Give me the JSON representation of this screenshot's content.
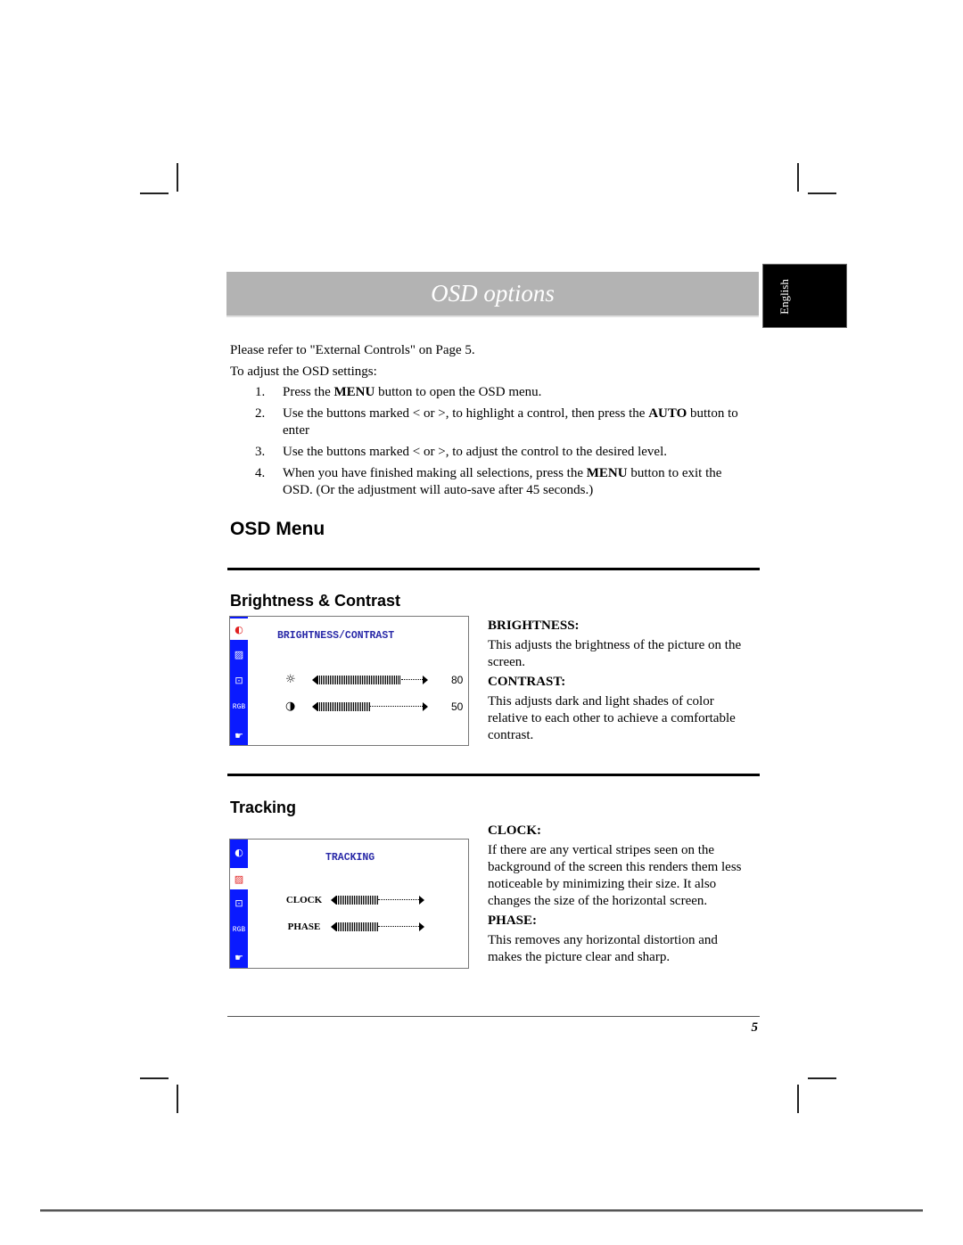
{
  "header": {
    "title": "OSD options",
    "language_tab": "English"
  },
  "intro": {
    "line1": "Please refer to \"External Controls\" on Page 5.",
    "line2": "To adjust the OSD settings:"
  },
  "steps": [
    {
      "num": "1.",
      "pre": "Press the ",
      "bold": "MENU",
      "post": " button to open the OSD menu."
    },
    {
      "num": "2.",
      "pre": "Use the buttons marked < or >, to highlight a control, then press the ",
      "bold": "AUTO",
      "post": " button to enter"
    },
    {
      "num": "3.",
      "pre": "Use the buttons marked < or >, to adjust the control to the desired level.",
      "bold": "",
      "post": ""
    },
    {
      "num": "4.",
      "pre": "When you have finished making all selections, press the ",
      "bold": "MENU",
      "post": " button to exit the OSD. (Or the adjustment will auto-save after 45 seconds.)"
    }
  ],
  "osd_menu": {
    "heading": "OSD Menu",
    "sidebar_icons": [
      "brightness-contrast-icon",
      "tracking-icon",
      "position-icon",
      "rgb-color-icon",
      "hand-tools-icon"
    ],
    "brightness_contrast": {
      "heading": "Brightness & Contrast",
      "screen_title": "BRIGHTNESS/CONTRAST",
      "controls": [
        {
          "icon": "sun-icon",
          "level": 80,
          "value": "80"
        },
        {
          "icon": "half-circle-contrast-icon",
          "level": 50,
          "value": "50"
        }
      ],
      "descriptions": [
        {
          "label": "BRIGHTNESS:",
          "text": "This adjusts the brightness of the picture on the screen."
        },
        {
          "label": "CONTRAST:",
          "text": "This adjusts dark and light shades of color relative to each other to achieve a comfortable contrast."
        }
      ]
    },
    "tracking": {
      "heading": "Tracking",
      "screen_title": "TRACKING",
      "controls": [
        {
          "label": "CLOCK",
          "level": 50
        },
        {
          "label": "PHASE",
          "level": 50
        }
      ],
      "descriptions": [
        {
          "label": "CLOCK:",
          "text": "If there are any vertical stripes seen on the background of the screen this renders them less noticeable by minimizing their size. It also changes the size of the horizontal screen."
        },
        {
          "label": "PHASE:",
          "text": "This removes any horizontal distortion and makes the picture clear and sharp."
        }
      ]
    }
  },
  "footer": {
    "page_number": "5"
  }
}
